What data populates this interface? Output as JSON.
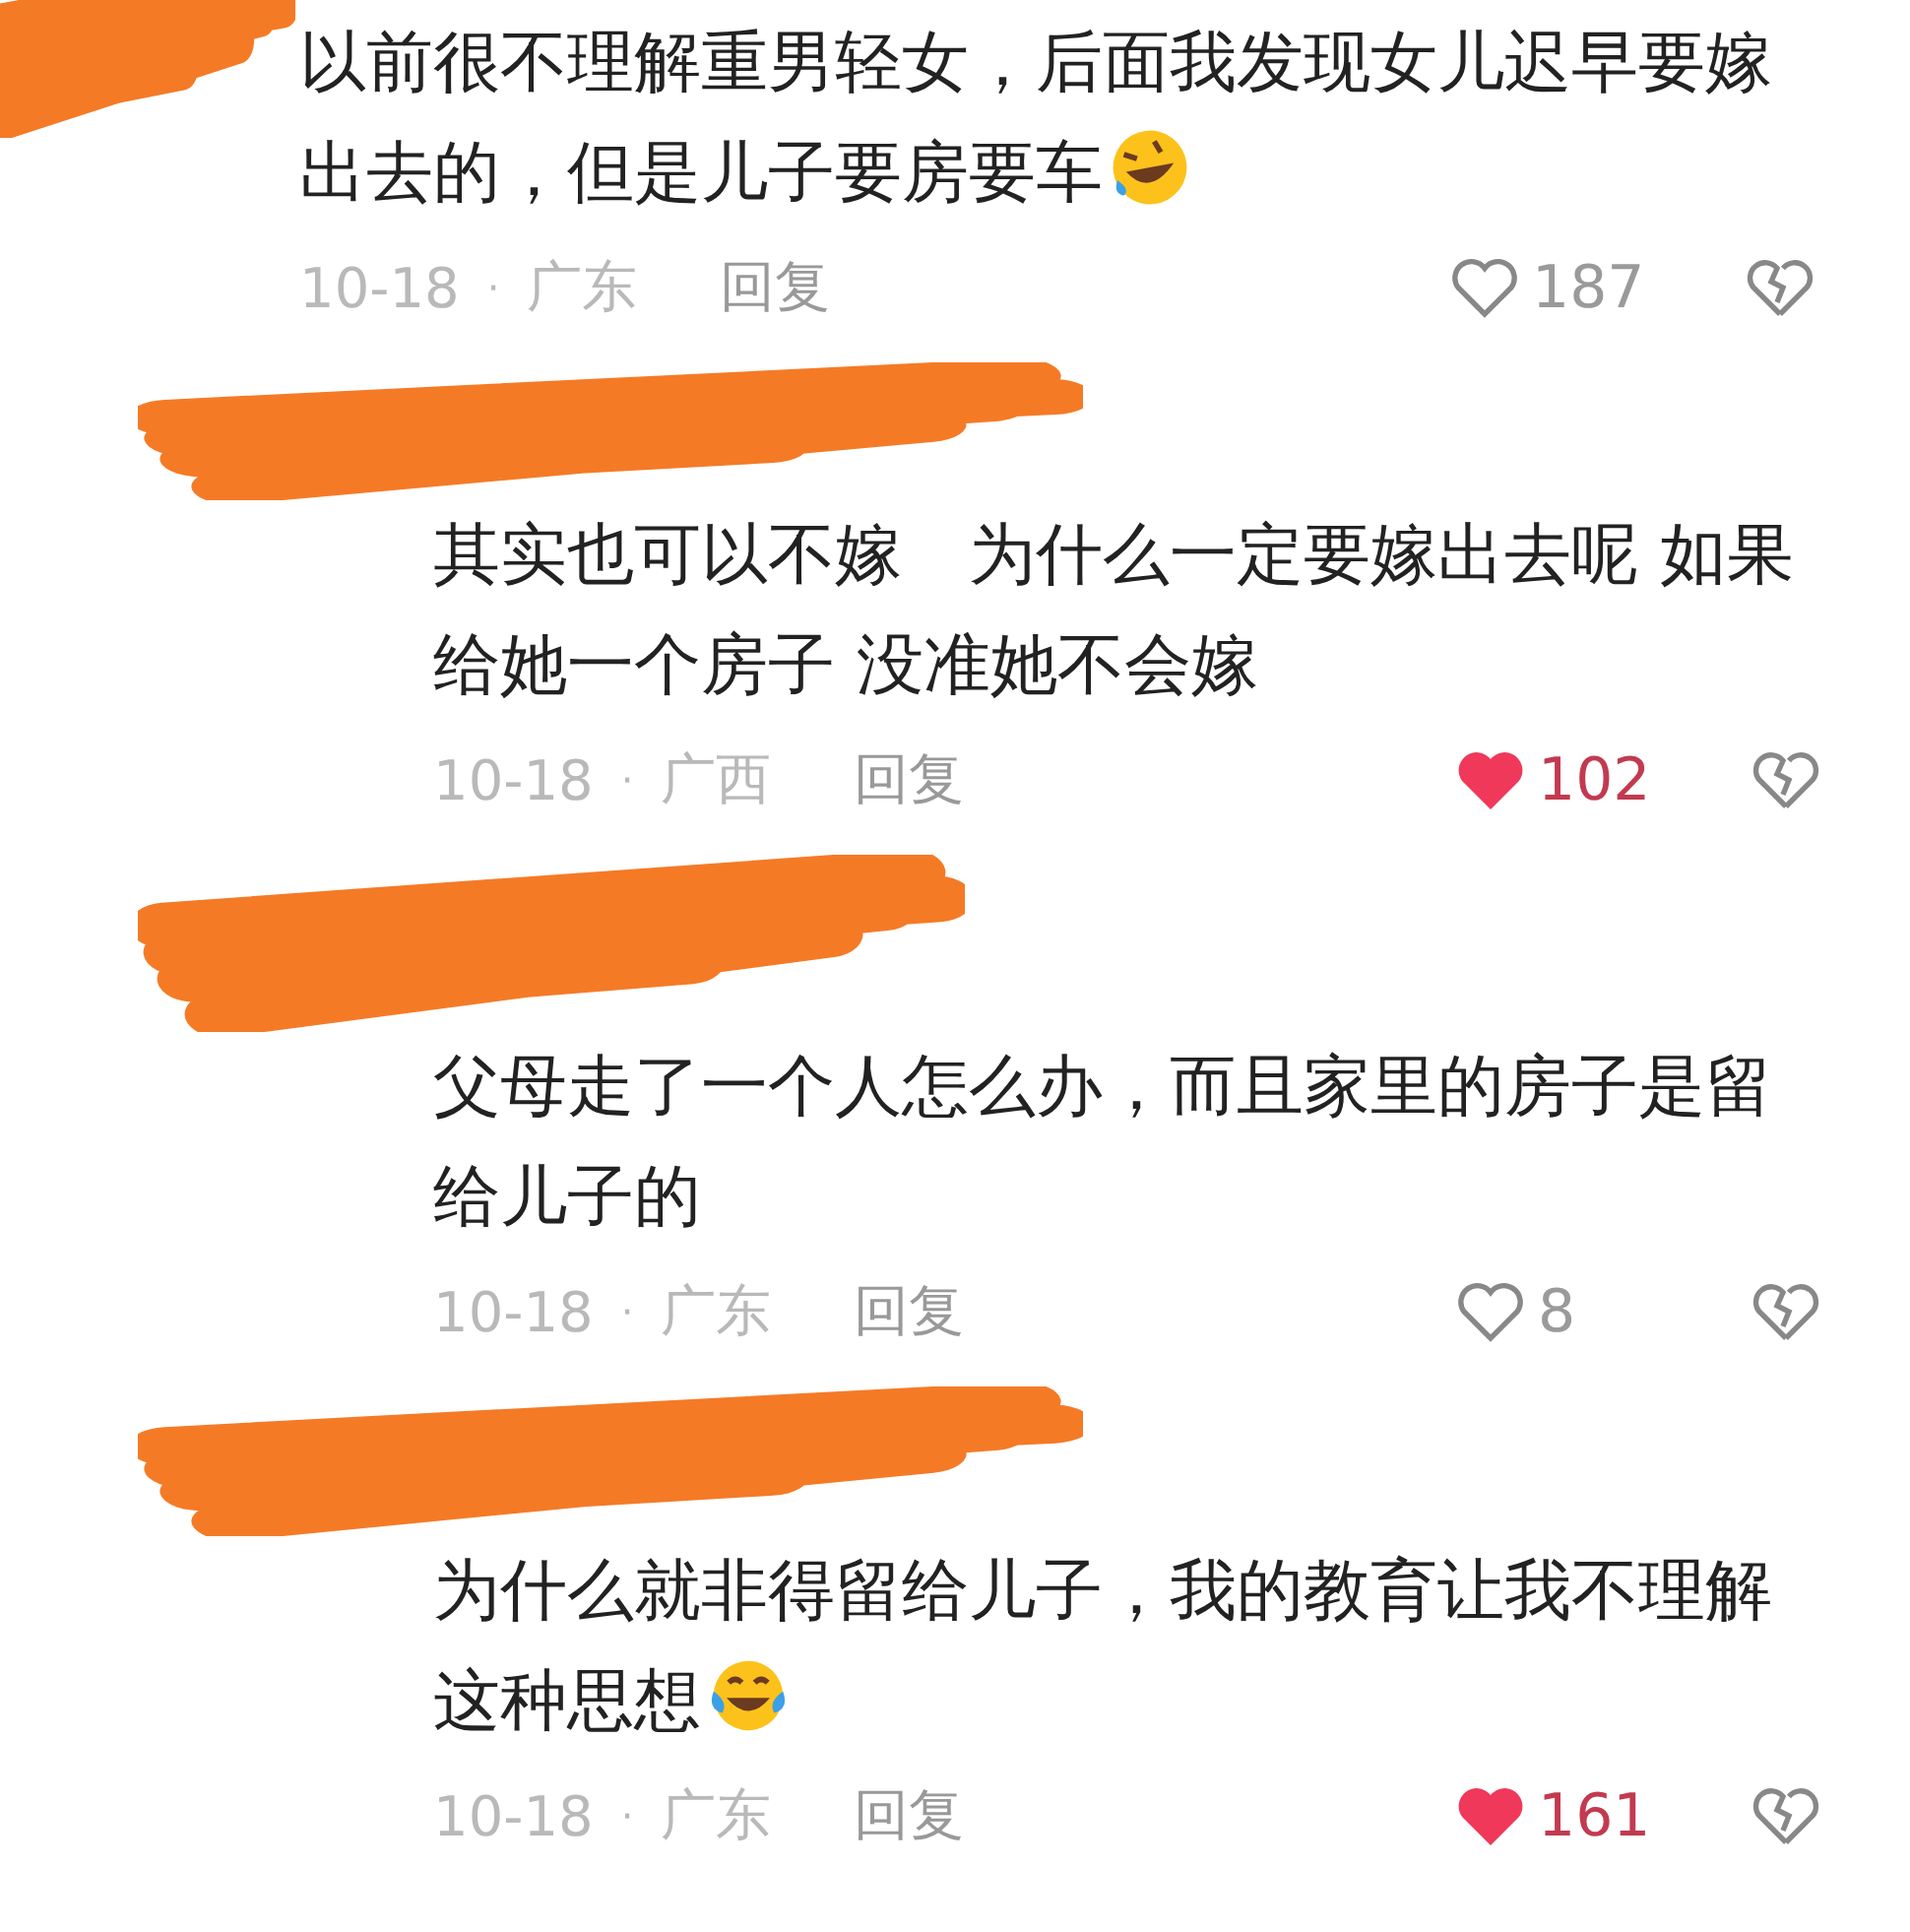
{
  "comments": [
    {
      "text": "以前很不理解重男轻女，后面我发现女儿迟早要嫁出去的，但是儿子要房要车",
      "emoji": {
        "kind": "rofl"
      },
      "date": "10-18",
      "separator": "·",
      "region": "广东",
      "reply": "回复",
      "likes": "187",
      "liked": false,
      "children": [
        {
          "text": "其实也可以不嫁　为什么一定要嫁出去呢 如果给她一个房子 没准她不会嫁",
          "date": "10-18",
          "separator": "·",
          "region": "广西",
          "reply": "回复",
          "likes": "102",
          "liked": true
        },
        {
          "text": "父母走了一个人怎么办，而且家里的房子是留给儿子的",
          "date": "10-18",
          "separator": "·",
          "region": "广东",
          "reply": "回复",
          "likes": "8",
          "liked": false
        },
        {
          "text": "为什么就非得留给儿子，我的教育让我不理解这种思想",
          "emoji": {
            "kind": "tears_of_joy"
          },
          "date": "10-18",
          "separator": "·",
          "region": "广东",
          "reply": "回复",
          "likes": "161",
          "liked": true
        }
      ]
    }
  ]
}
